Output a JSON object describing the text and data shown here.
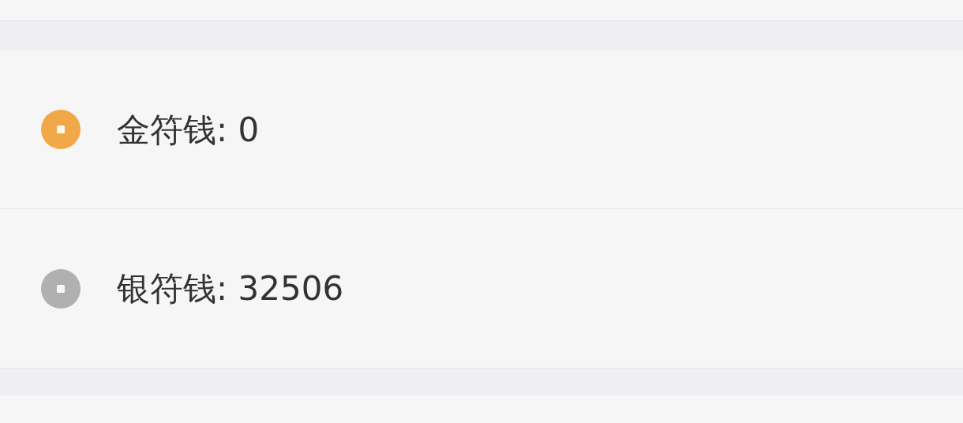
{
  "balances": [
    {
      "label": "金符钱: 0",
      "color": "#f0a848"
    },
    {
      "label": "银符钱: 32506",
      "color": "#b0b0b0"
    }
  ]
}
